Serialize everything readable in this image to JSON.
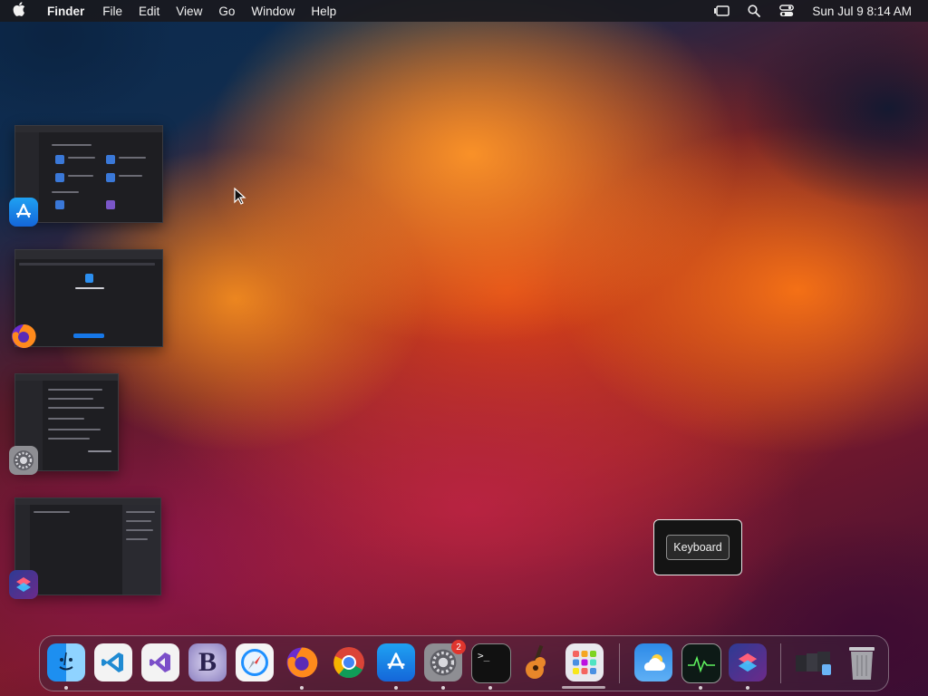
{
  "menubar": {
    "apple_icon": "apple-icon",
    "app_name": "Finder",
    "menus": [
      "File",
      "Edit",
      "View",
      "Go",
      "Window",
      "Help"
    ],
    "status_icons": [
      "stage-manager-icon",
      "search-icon",
      "control-center-icon"
    ],
    "clock": "Sun Jul 9  8:14 AM"
  },
  "stage_manager": {
    "windows": [
      {
        "app": "App Store",
        "icon": "app-store-icon"
      },
      {
        "app": "Firefox",
        "icon": "firefox-icon"
      },
      {
        "app": "System Settings",
        "icon": "system-settings-icon"
      },
      {
        "app": "Shortcuts",
        "icon": "shortcuts-icon"
      }
    ]
  },
  "tooltip": {
    "label": "Keyboard"
  },
  "dock": {
    "apps": [
      {
        "name": "Finder",
        "icon": "finder-icon",
        "running": true
      },
      {
        "name": "Visual Studio Code",
        "icon": "vscode-icon",
        "running": false
      },
      {
        "name": "Visual Studio",
        "icon": "visual-studio-icon",
        "running": false
      },
      {
        "name": "BBEdit",
        "icon": "bbedit-icon",
        "running": false
      },
      {
        "name": "Safari",
        "icon": "safari-icon",
        "running": false
      },
      {
        "name": "Firefox",
        "icon": "firefox-icon",
        "running": true
      },
      {
        "name": "Google Chrome",
        "icon": "chrome-icon",
        "running": false
      },
      {
        "name": "App Store",
        "icon": "app-store-icon",
        "running": true
      },
      {
        "name": "System Settings",
        "icon": "system-settings-icon",
        "running": true,
        "badge": "2"
      },
      {
        "name": "Terminal",
        "icon": "terminal-icon",
        "running": true
      },
      {
        "name": "GarageBand",
        "icon": "garageband-icon",
        "running": false
      },
      {
        "name": "Launchpad",
        "icon": "launchpad-icon",
        "running": false
      },
      {
        "name": "Weather",
        "icon": "weather-icon",
        "running": false
      },
      {
        "name": "Activity Monitor",
        "icon": "activity-monitor-icon",
        "running": true
      },
      {
        "name": "Shortcuts",
        "icon": "shortcuts-icon",
        "running": true
      },
      {
        "name": "Downloads",
        "icon": "downloads-stack-icon",
        "running": false
      },
      {
        "name": "Trash",
        "icon": "trash-icon",
        "running": false
      }
    ],
    "terminal_prompt": ">_",
    "bbedit_letter": "B"
  },
  "colors": {
    "menubar_bg": "#19191e",
    "accent_blue": "#2f6fd6",
    "badge_red": "#e0352d"
  }
}
